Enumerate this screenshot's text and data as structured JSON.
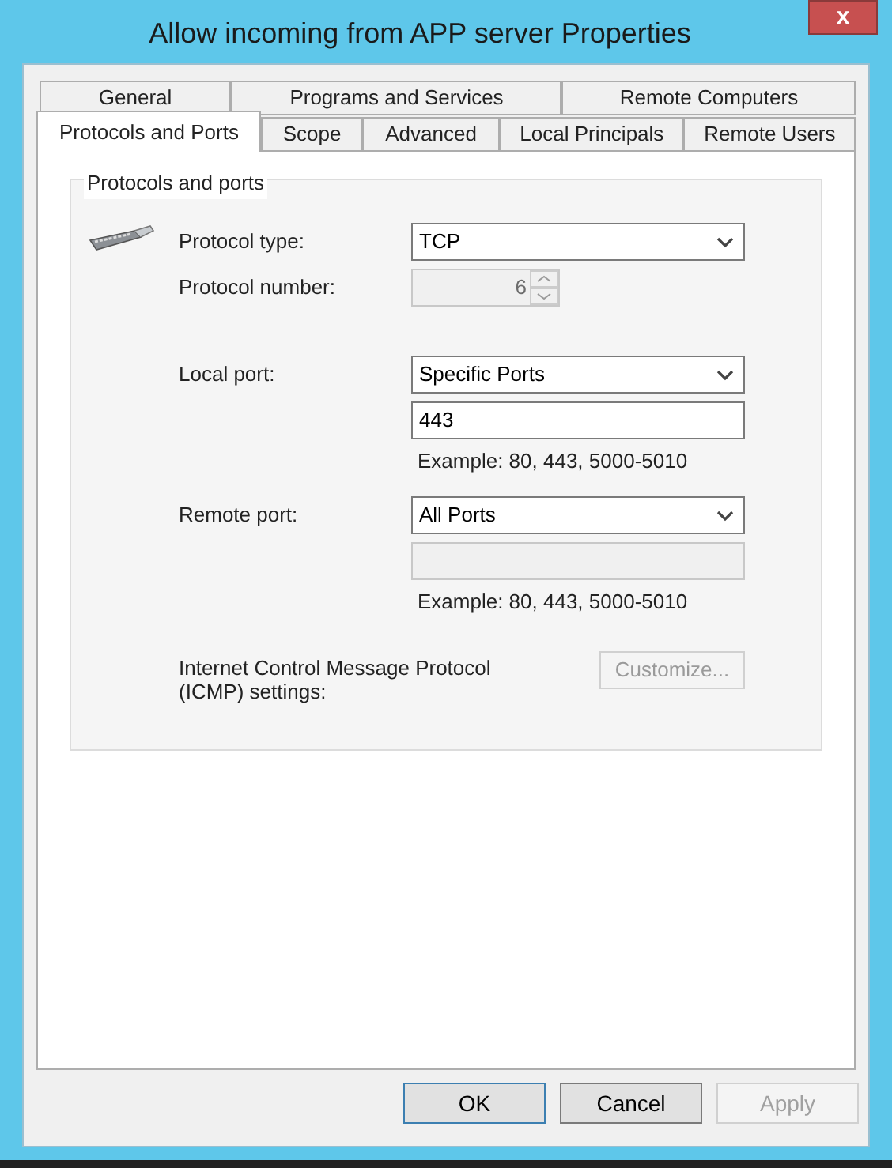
{
  "window": {
    "title": "Allow incoming from APP server Properties",
    "close": "x"
  },
  "tabs": [
    [
      {
        "label": "General",
        "selected": false
      },
      {
        "label": "Programs and Services",
        "selected": false
      },
      {
        "label": "Remote Computers",
        "selected": false
      }
    ],
    [
      {
        "label": "Protocols and Ports",
        "selected": true
      },
      {
        "label": "Scope",
        "selected": false
      },
      {
        "label": "Advanced",
        "selected": false
      },
      {
        "label": "Local Principals",
        "selected": false
      },
      {
        "label": "Remote Users",
        "selected": false
      }
    ]
  ],
  "group": {
    "title": "Protocols and ports",
    "rows": [
      {
        "kind": "select",
        "label": "Protocol type:",
        "value": "TCP"
      },
      {
        "kind": "spinner",
        "label": "Protocol number:",
        "value": "6",
        "disabled": true
      },
      {
        "kind": "gap"
      },
      {
        "kind": "select",
        "label": "Local port:",
        "value": "Specific Ports"
      },
      {
        "kind": "input",
        "value": "443",
        "disabled": false
      },
      {
        "kind": "hint",
        "text": "Example: 80, 443, 5000-5010"
      },
      {
        "kind": "select",
        "label": "Remote port:",
        "value": "All Ports"
      },
      {
        "kind": "input",
        "value": "",
        "disabled": true
      },
      {
        "kind": "hint",
        "text": "Example: 80, 443, 5000-5010"
      },
      {
        "kind": "button",
        "label": "Internet Control Message Protocol (ICMP) settings:",
        "button": "Customize...",
        "disabled": true
      }
    ]
  },
  "buttons": [
    {
      "label": "OK",
      "default": true,
      "disabled": false
    },
    {
      "label": "Cancel",
      "default": false,
      "disabled": false
    },
    {
      "label": "Apply",
      "default": false,
      "disabled": true
    }
  ]
}
